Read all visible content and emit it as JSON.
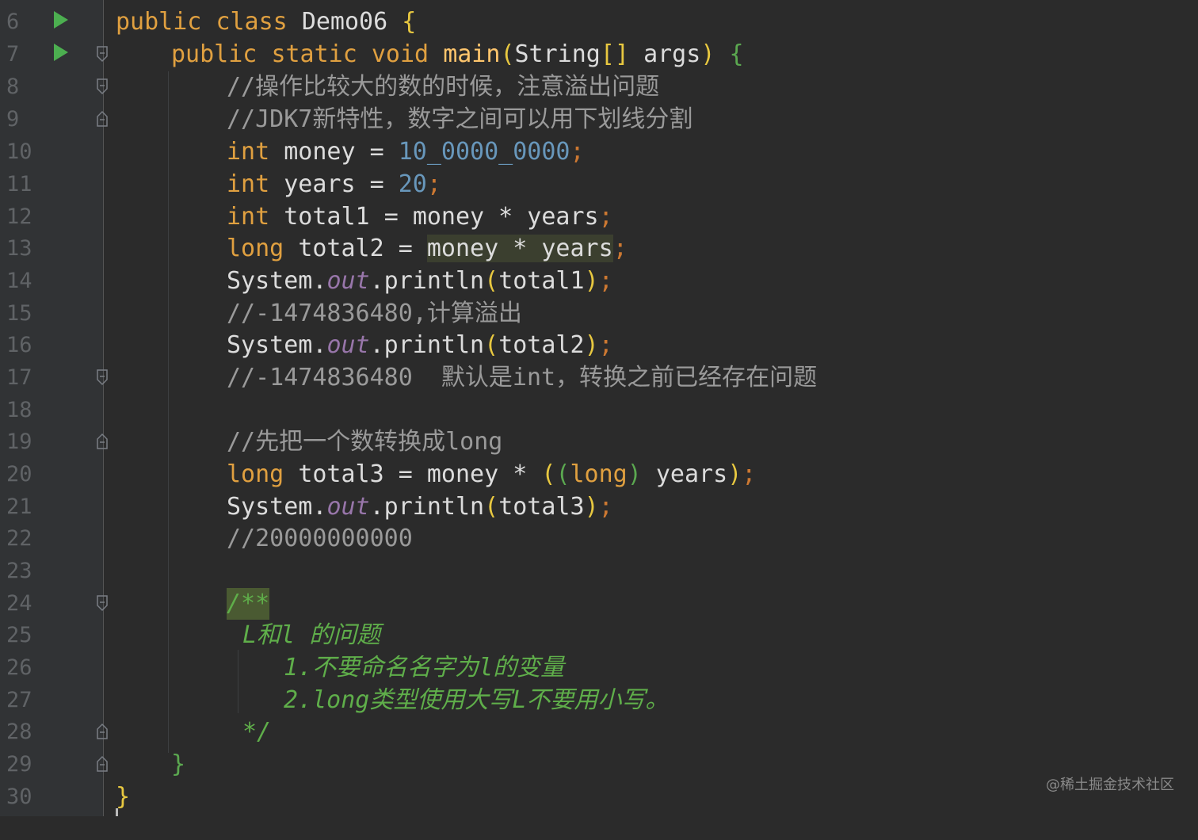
{
  "lines": [
    {
      "n": "6"
    },
    {
      "n": "7"
    },
    {
      "n": "8"
    },
    {
      "n": "9"
    },
    {
      "n": "10"
    },
    {
      "n": "11"
    },
    {
      "n": "12"
    },
    {
      "n": "13"
    },
    {
      "n": "14"
    },
    {
      "n": "15"
    },
    {
      "n": "16"
    },
    {
      "n": "17"
    },
    {
      "n": "18"
    },
    {
      "n": "19"
    },
    {
      "n": "20"
    },
    {
      "n": "21"
    },
    {
      "n": "22"
    },
    {
      "n": "23"
    },
    {
      "n": "24"
    },
    {
      "n": "25"
    },
    {
      "n": "26"
    },
    {
      "n": "27"
    },
    {
      "n": "28"
    },
    {
      "n": "29"
    },
    {
      "n": "30"
    }
  ],
  "code": {
    "l6": {
      "kw1": "public",
      "kw2": "class",
      "name": "Demo06",
      "brace": "{"
    },
    "l7": {
      "kw1": "public",
      "kw2": "static",
      "kw3": "void",
      "fn": "main",
      "p1": "(",
      "type": "String",
      "arr": "[]",
      "arg": "args",
      "p2": ")",
      "brace": "{"
    },
    "l8": "//操作比较大的数的时候，注意溢出问题",
    "l9": "//JDK7新特性，数字之间可以用下划线分割",
    "l10": {
      "kw": "int",
      "var": "money",
      "eq": "=",
      "num": "10_0000_0000",
      "semi": ";"
    },
    "l11": {
      "kw": "int",
      "var": "years",
      "eq": "=",
      "num": "20",
      "semi": ";"
    },
    "l12": {
      "kw": "int",
      "var": "total1",
      "eq": "=",
      "expr": "money * years",
      "semi": ";"
    },
    "l13": {
      "kw": "long",
      "var": "total2",
      "eq": "=",
      "expr": "money * years",
      "semi": ";"
    },
    "l14": {
      "sys": "System",
      "dot": ".",
      "out": "out",
      "call": ".println",
      "p1": "(",
      "arg": "total1",
      "p2": ")",
      "semi": ";"
    },
    "l15": "//-1474836480,计算溢出",
    "l16": {
      "sys": "System",
      "dot": ".",
      "out": "out",
      "call": ".println",
      "p1": "(",
      "arg": "total2",
      "p2": ")",
      "semi": ";"
    },
    "l17": "//-1474836480  默认是int，转换之前已经存在问题",
    "l19": "//先把一个数转换成long",
    "l20": {
      "kw": "long",
      "var": "total3",
      "eq": "=",
      "a": "money *",
      "p1": "(",
      "p2": "(",
      "cast": "long",
      "p3": ")",
      "b": "years",
      "p4": ")",
      "semi": ";"
    },
    "l21": {
      "sys": "System",
      "dot": ".",
      "out": "out",
      "call": ".println",
      "p1": "(",
      "arg": "total3",
      "p2": ")",
      "semi": ";"
    },
    "l22": "//20000000000",
    "l24": "/**",
    "l25": "L和l 的问题",
    "l26": "1.不要命名名字为l的变量",
    "l27": "2.long类型使用大写L不要用小写。",
    "l28": "*/",
    "l29": "}",
    "l30": "}"
  },
  "watermark": "@稀土掘金技术社区",
  "colors": {
    "background": "#2b2b2b",
    "keyword": "#e0a040",
    "number": "#6897bb",
    "comment": "#9a9a9a",
    "doc_comment": "#5fae4a",
    "static_field": "#9876aa",
    "run_icon": "#4caf50"
  }
}
